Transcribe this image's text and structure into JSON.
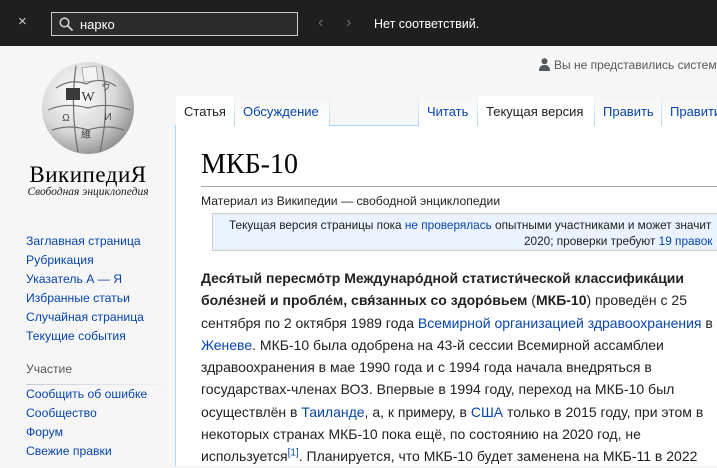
{
  "findbar": {
    "close_label": "×",
    "query": "нарко",
    "prev_label": "‹",
    "next_label": "›",
    "status": "Нет соответствий."
  },
  "sidebar": {
    "wordmark": "ВикипедиЯ",
    "tagline": "Свободная энциклопедия",
    "main_nav": [
      "Заглавная страница",
      "Рубрикация",
      "Указатель А — Я",
      "Избранные статьи",
      "Случайная страница",
      "Текущие события"
    ],
    "participation_title": "Участие",
    "participation_nav": [
      "Сообщить об ошибке",
      "Сообщество",
      "Форум",
      "Свежие правки"
    ]
  },
  "personal": {
    "not_logged_in": "Вы не представились систем"
  },
  "tabs": {
    "article": "Статья",
    "talk": "Обсуждение",
    "read": "Читать",
    "current": "Текущая версия",
    "edit": "Править",
    "edit_source": "Правити"
  },
  "article": {
    "title": "МКБ-10",
    "site_sub": "Материал из Википедии — свободной энциклопедии",
    "notice": {
      "l1_a": "Текущая версия страницы пока ",
      "l1_link": "не проверялась",
      "l1_b": " опытными участниками и может значит",
      "l2_a": "2020; проверки требуют ",
      "l2_link": "19 правок"
    },
    "para": {
      "l1_bold": "Деся́тый пересмо́тр Междунаро́дной статисти́ческой классифика́ции",
      "l2_bold": "боле́зней и пробле́м, свя́занных со здоро́вьем",
      "l2_a": " (",
      "l2_bold2": "МКБ-10",
      "l2_b": ") проведён с 25",
      "l3_a": "сентября по 2 октября 1989 года ",
      "l3_link": "Всемирной организацией здравоохранения",
      "l3_b": " в",
      "l4_link": "Женеве",
      "l4_b": ". МКБ-10 была одобрена на 43-й сессии Всемирной ассамблеи",
      "l5": "здравоохранения в мае 1990 года и с 1994 года начала внедряться в",
      "l6": "государствах-членах ВОЗ. Впервые в 1994 году, переход на МКБ-10 был",
      "l7_a": "осуществлён в ",
      "l7_link1": "Таиланде",
      "l7_b": ", а, к примеру, в ",
      "l7_link2": "США",
      "l7_c": " только в 2015 году, при этом в",
      "l8": "некоторых странах МКБ-10 пока ещё, по состоянию на 2020 год, не",
      "l9_a": "используется",
      "l9_ref": "[1]",
      "l9_b": ". Планируется, что МКБ-10 будет заменена на МКБ-11 в 2022"
    }
  },
  "icons": {
    "search": "search-icon",
    "user": "user-icon",
    "globe": "wikipedia-globe-logo"
  }
}
